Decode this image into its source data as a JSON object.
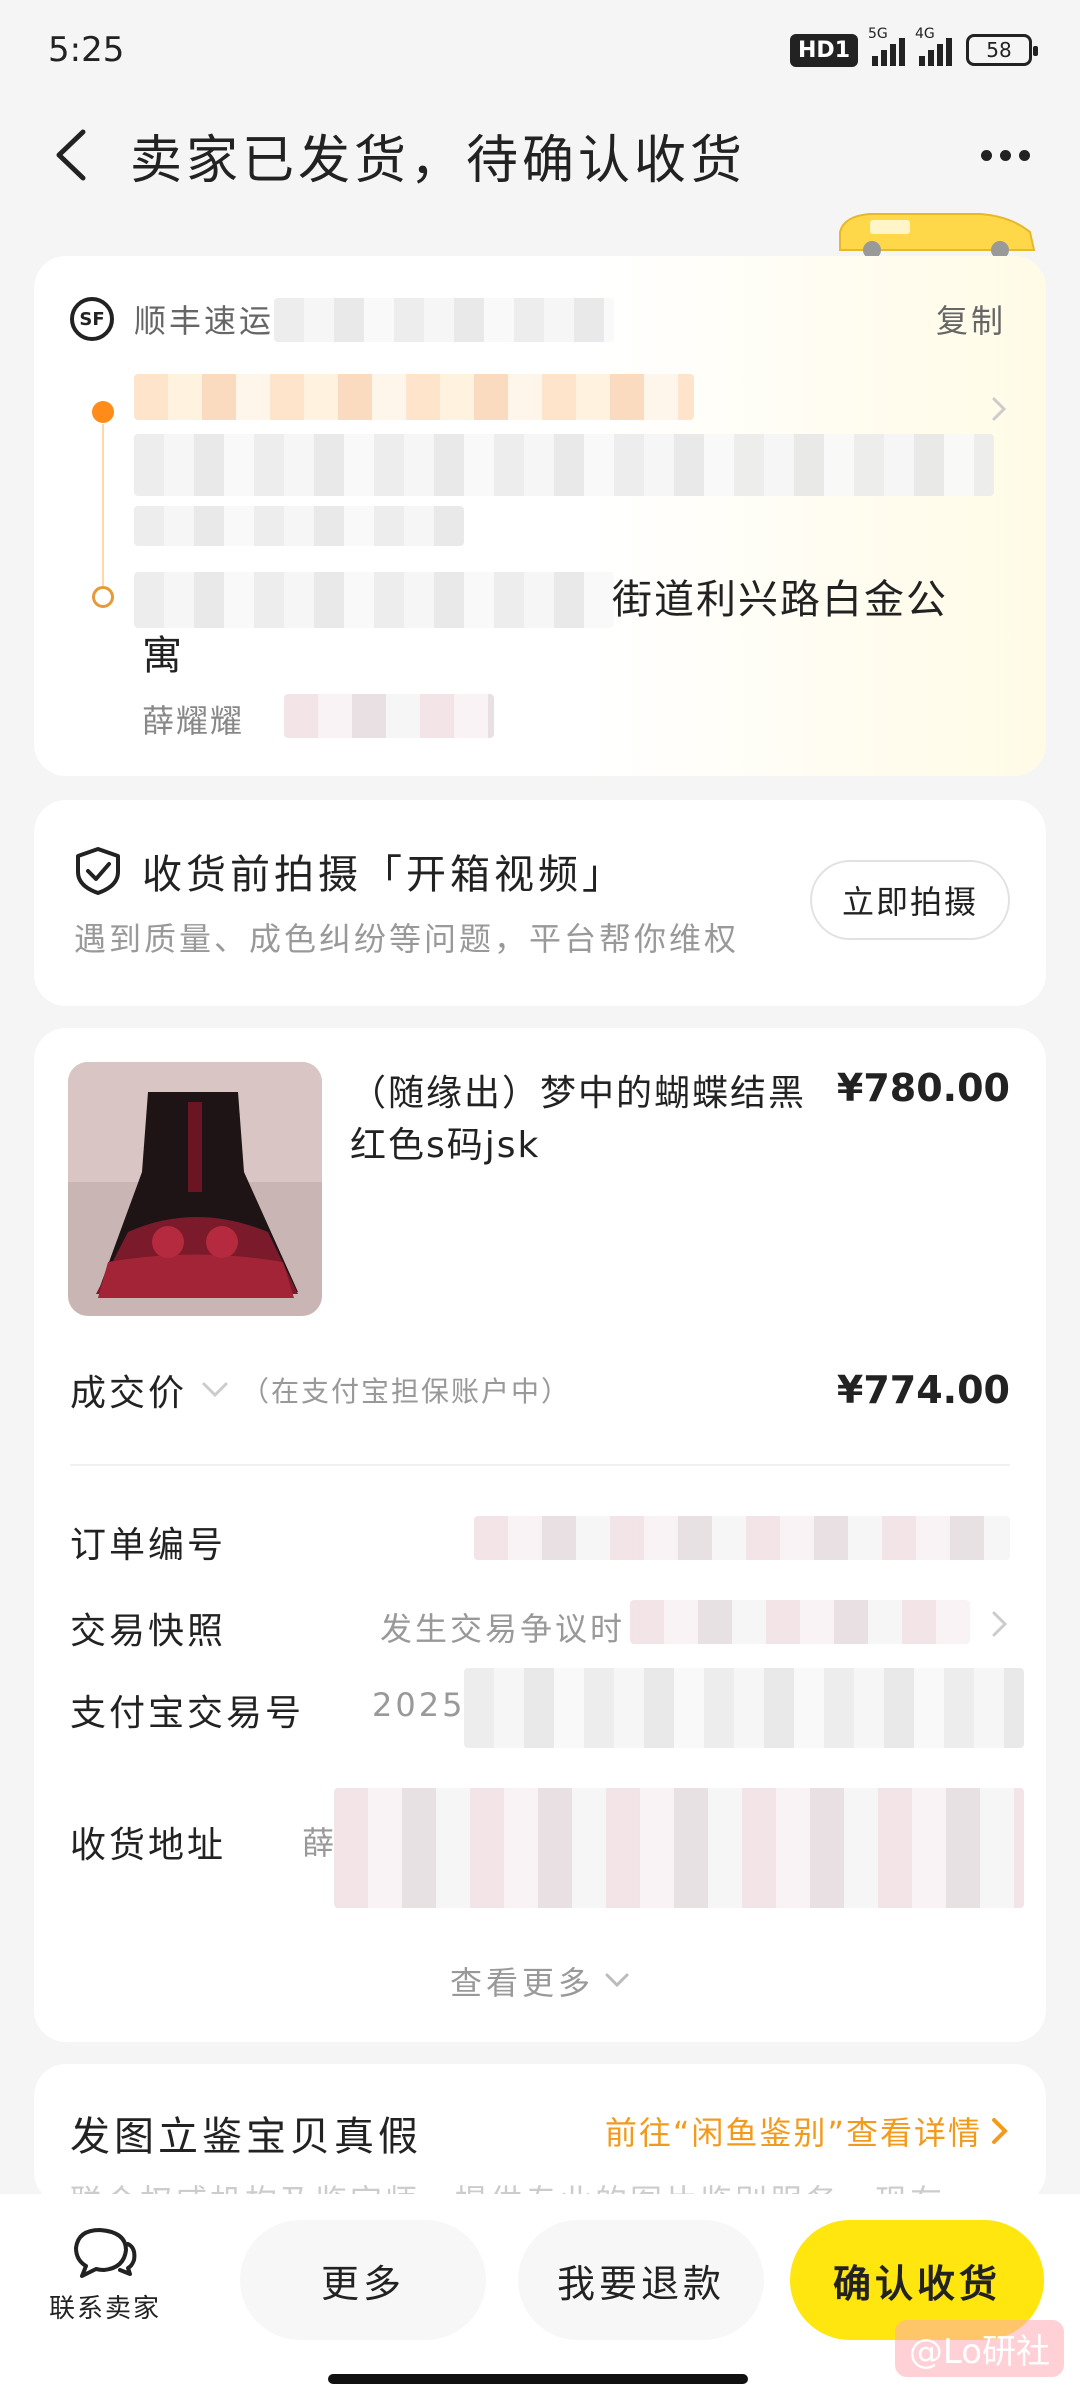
{
  "status_bar": {
    "time": "5:25",
    "hd": "HD1",
    "net1": "5G",
    "net2": "4G",
    "battery": "58"
  },
  "nav": {
    "title": "卖家已发货，待确认收货"
  },
  "logistics": {
    "carrier": "顺丰速运",
    "copy_label": "复制",
    "address": "街道利兴路白金公寓",
    "receiver": "薛耀耀"
  },
  "video": {
    "title": "收货前拍摄「开箱视频」",
    "desc": "遇到质量、成色纠纷等问题，平台帮你维权",
    "button": "立即拍摄"
  },
  "order": {
    "product_title": "（随缘出）梦中的蝴蝶结黑红色s码jsk",
    "product_price": "¥780.00",
    "deal_label": "成交价",
    "deal_note": "（在支付宝担保账户中）",
    "deal_price": "¥774.00",
    "rows": [
      {
        "label": "订单编号",
        "value": ""
      },
      {
        "label": "交易快照",
        "value": "发生交易争议时"
      },
      {
        "label": "支付宝交易号",
        "value": "2025"
      },
      {
        "label": "收货地址",
        "value": "薛"
      }
    ],
    "show_more": "查看更多"
  },
  "auth": {
    "title": "发图立鉴宝贝真假",
    "link": "前往“闲鱼鉴别”查看详情",
    "desc": "联合权威机构及鉴定师，提供专业的图片鉴别服务，现在"
  },
  "bottom": {
    "contact": "联系卖家",
    "more": "更多",
    "refund": "我要退款",
    "confirm": "确认收货"
  },
  "watermark": "@Lo研社",
  "colors": {
    "accent_yellow": "#ffe60f",
    "link_orange": "#f29a1c",
    "timeline_orange": "#ff8c1a"
  }
}
